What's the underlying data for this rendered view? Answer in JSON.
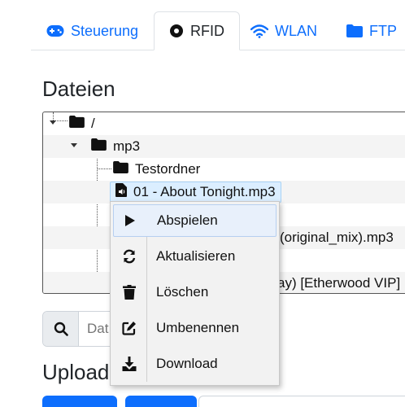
{
  "tabs": [
    {
      "label": "Steuerung",
      "icon": "gamepad-icon"
    },
    {
      "label": "RFID",
      "icon": "rfid-disc-icon",
      "active": true
    },
    {
      "label": "WLAN",
      "icon": "wifi-icon"
    },
    {
      "label": "FTP",
      "icon": "folder-icon"
    }
  ],
  "files_heading": "Dateien",
  "tree": {
    "root": "/",
    "mp3_folder": "mp3",
    "testordner": "Testordner",
    "selected_file": "01 - About Tonight.mp3",
    "partial_file_1": "(original_mix).mp3",
    "partial_file_2": "ay) [Etherwood VIP]"
  },
  "search": {
    "placeholder": "Dat"
  },
  "upload_heading": "Upload",
  "context_menu": {
    "items": [
      {
        "label": "Abspielen",
        "icon": "play-icon"
      },
      {
        "label": "Aktualisieren",
        "icon": "refresh-icon"
      },
      {
        "label": "Löschen",
        "icon": "trash-icon"
      },
      {
        "label": "Umbenennen",
        "icon": "edit-icon"
      },
      {
        "label": "Download",
        "icon": "download-icon"
      }
    ]
  },
  "colors": {
    "accent": "#0d6efd",
    "selected_bg": "#dbeeff",
    "menu_bg": "#f2f2f2"
  }
}
